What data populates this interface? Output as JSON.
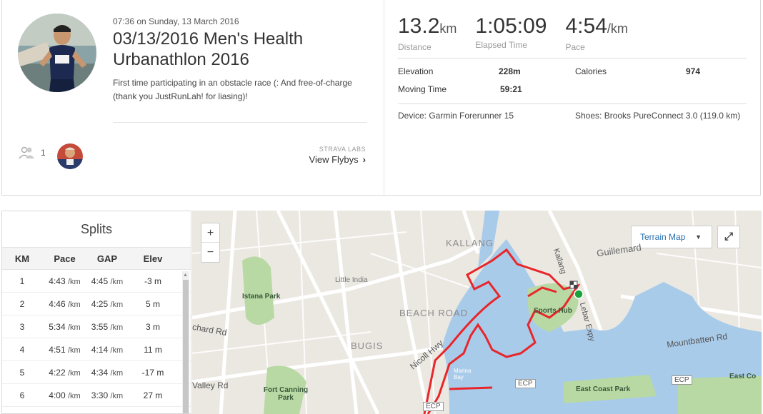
{
  "activity": {
    "timestamp": "07:36 on Sunday, 13 March 2016",
    "title": "03/13/2016 Men's Health Urbanathlon 2016",
    "description": "First time participating in an obstacle race (: And free-of-charge (thank you JustRunLah! for liasing)!",
    "kudos_count": "1",
    "flybys_label": "STRAVA LABS",
    "flybys_link": "View Flybys"
  },
  "stats": {
    "distance": {
      "value": "13.2",
      "unit": "km",
      "label": "Distance"
    },
    "elapsed": {
      "value": "1:05:09",
      "label": "Elapsed Time"
    },
    "pace": {
      "value": "4:54",
      "unit": "/km",
      "label": "Pace"
    },
    "details": {
      "elevation_label": "Elevation",
      "elevation": "228m",
      "moving_label": "Moving Time",
      "moving": "59:21",
      "calories_label": "Calories",
      "calories": "974"
    },
    "device": "Device: Garmin Forerunner 15",
    "shoes": "Shoes: Brooks PureConnect 3.0 (119.0 km)"
  },
  "splits": {
    "title": "Splits",
    "headers": {
      "km": "KM",
      "pace": "Pace",
      "gap": "GAP",
      "elev": "Elev"
    },
    "rows": [
      {
        "km": "1",
        "pace": "4:43",
        "gap": "4:45",
        "elev": "-3 m"
      },
      {
        "km": "2",
        "pace": "4:46",
        "gap": "4:25",
        "elev": "5 m"
      },
      {
        "km": "3",
        "pace": "5:34",
        "gap": "3:55",
        "elev": "3 m"
      },
      {
        "km": "4",
        "pace": "4:51",
        "gap": "4:14",
        "elev": "11 m"
      },
      {
        "km": "5",
        "pace": "4:22",
        "gap": "4:34",
        "elev": "-17 m"
      },
      {
        "km": "6",
        "pace": "4:00",
        "gap": "3:30",
        "elev": "27 m"
      }
    ],
    "pace_unit": "/km"
  },
  "map": {
    "zoom_in": "+",
    "zoom_out": "−",
    "map_type": "Terrain Map",
    "labels": {
      "kallang": "KALLANG",
      "guillemard": "Guillemard",
      "kallang_road": "Kallang",
      "little_india": "Little India",
      "istana_park": "Istana Park",
      "beach_road": "BEACH ROAD",
      "sports_hub": "Sports Hub",
      "lebar_expy": "Lebar Expy",
      "orchard_rd": "chard Rd",
      "bugis": "BUGIS",
      "nicoll_hwy": "Nicoll Hwy",
      "mountbatten_rd": "Mountbatten Rd",
      "marina_bay": "Marina Bay",
      "valley_rd": "Valley Rd",
      "fort_canning": "Fort Canning Park",
      "ecp1": "ECP",
      "ecp2": "ECP",
      "ecp3": "ECP",
      "east_coast_park": "East Coast Park",
      "east_coast_cut": "East Co"
    },
    "colors": {
      "route": "#e8262a",
      "water": "#a9cbea",
      "park": "#b8d9a4",
      "start": "#19a33b"
    }
  }
}
